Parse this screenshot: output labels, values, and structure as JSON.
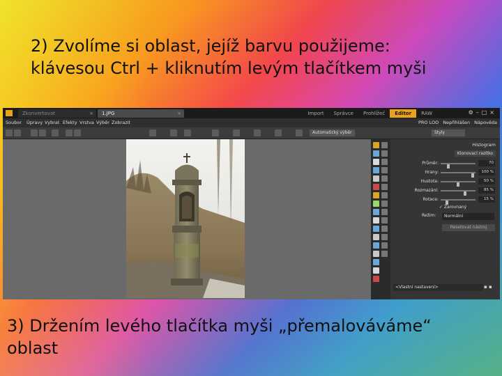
{
  "captions": {
    "top_line1": "2) Zvolíme si oblast, jejíž barvu použijeme:",
    "top_line2": "klávesou Ctrl + kliknutím levým tlačítkem myši",
    "bottom_line1": "3) Držením levého tlačítka myši „přemalováváme“",
    "bottom_line2": "oblast"
  },
  "app": {
    "tabs": [
      {
        "label": "Zkonvertovat",
        "close": "×"
      },
      {
        "label": "1.JPG",
        "close": "×"
      }
    ],
    "modes": [
      "Import",
      "Správce",
      "Prohlížeč",
      "Editor",
      "RAW"
    ],
    "active_mode": "Editor",
    "menu": [
      "Soubor",
      "Úpravy",
      "Vybrat",
      "Efekty",
      "Vrstva",
      "Výběr",
      "Zobrazit"
    ],
    "menu_right": [
      "PRO LOO",
      "Nepřihlášen",
      "Nápověda"
    ],
    "toolbar": {
      "auto_button": "Automatický výběr",
      "preset": "Styly"
    },
    "panel": {
      "header": "Histogram",
      "subheader": "Klonovací razítko",
      "rows": [
        {
          "label": "Průměr:",
          "value": "70",
          "fraction": 0.2
        },
        {
          "label": "Hrany:",
          "value": "100 %",
          "fraction": 0.95
        },
        {
          "label": "Hustota:",
          "value": "50 %",
          "fraction": 0.5
        },
        {
          "label": "Rozmazání:",
          "value": "85 %",
          "fraction": 0.72
        },
        {
          "label": "Rotace:",
          "value": "15 %",
          "fraction": 0.15
        }
      ],
      "checkbox_label": "✓ Zarovnaný",
      "mode_label": "Režim:",
      "mode_value": "Normální",
      "reset_button": "Resetovat nástroj",
      "bottom_select": "<Vlastní nastavení>"
    }
  }
}
